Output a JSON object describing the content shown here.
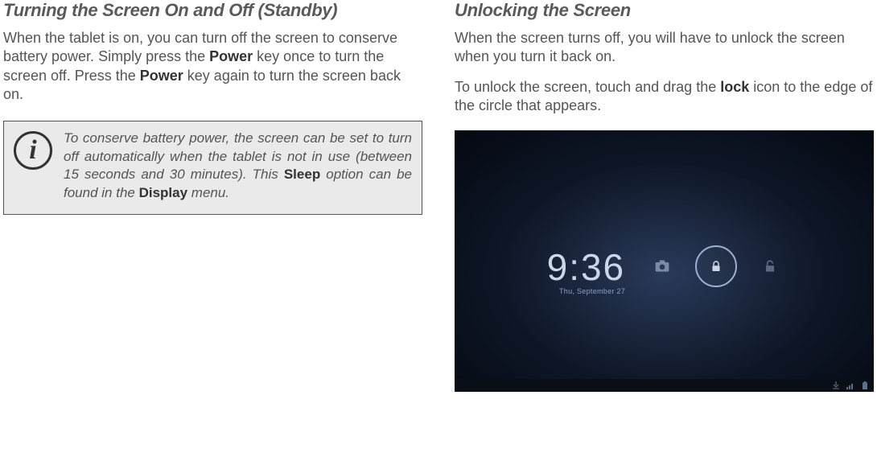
{
  "left": {
    "heading": "Turning the Screen On and Off (Standby)",
    "p1_a": "When the tablet is on, you can turn off the screen to conserve battery power. Simply press the ",
    "p1_b": "Power",
    "p1_c": " key once to turn the screen off. Press the ",
    "p1_d": "Power",
    "p1_e": " key again to turn the screen back on.",
    "note_a": "To conserve battery power, the screen can be set to turn off automatically when the tablet is not in use (between 15 seconds and 30 minutes). This ",
    "note_b": "Sleep",
    "note_c": " option can be found in the ",
    "note_d": "Display",
    "note_e": " menu.",
    "info_glyph": "i"
  },
  "right": {
    "heading": "Unlocking the Screen",
    "p1": "When the screen turns off, you will have to unlock the screen when you turn it back on.",
    "p2_a": "To unlock the screen, touch and drag the ",
    "p2_b": "lock",
    "p2_c": " icon to the edge of the circle that appears."
  },
  "lockscreen": {
    "time": "9:36",
    "date": "Thu, September 27"
  }
}
